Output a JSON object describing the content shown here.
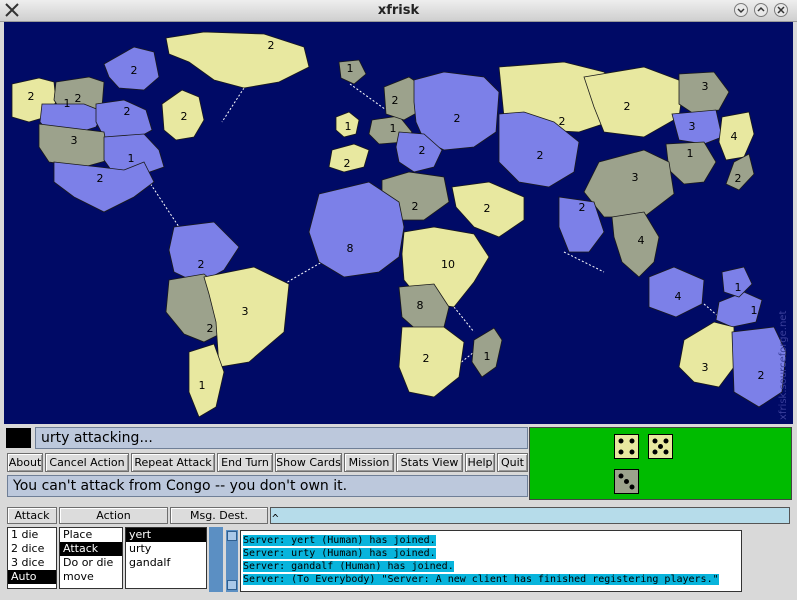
{
  "window": {
    "title": "xfrisk"
  },
  "map": {
    "watermark": "xfrisk.sourceforge.net",
    "colors": {
      "ocean": "#000a66",
      "yellow": "#e8e8a0",
      "blue": "#7c80e8",
      "gray": "#9ca28c"
    },
    "armies": [
      {
        "n": "2",
        "c": "yellow"
      },
      {
        "n": "2",
        "c": "gray"
      },
      {
        "n": "2",
        "c": "blue"
      },
      {
        "n": "2",
        "c": "yellow"
      },
      {
        "n": "1",
        "c": "blue"
      },
      {
        "n": "2",
        "c": "blue"
      },
      {
        "n": "2",
        "c": "yellow"
      },
      {
        "n": "3",
        "c": "gray"
      },
      {
        "n": "1",
        "c": "blue"
      },
      {
        "n": "2",
        "c": "blue"
      },
      {
        "n": "1",
        "c": "gray"
      },
      {
        "n": "1",
        "c": "yellow"
      },
      {
        "n": "1",
        "c": "gray"
      },
      {
        "n": "2",
        "c": "yellow"
      },
      {
        "n": "2",
        "c": "gray"
      },
      {
        "n": "2",
        "c": "blue"
      },
      {
        "n": "2",
        "c": "blue"
      },
      {
        "n": "2",
        "c": "yellow"
      },
      {
        "n": "2",
        "c": "yellow"
      },
      {
        "n": "2",
        "c": "blue"
      },
      {
        "n": "3",
        "c": "gray"
      },
      {
        "n": "3",
        "c": "blue"
      },
      {
        "n": "4",
        "c": "yellow"
      },
      {
        "n": "1",
        "c": "gray"
      },
      {
        "n": "2",
        "c": "gray"
      },
      {
        "n": "3",
        "c": "gray"
      },
      {
        "n": "2",
        "c": "gray"
      },
      {
        "n": "2",
        "c": "blue"
      },
      {
        "n": "2",
        "c": "yellow"
      },
      {
        "n": "4",
        "c": "gray"
      },
      {
        "n": "8",
        "c": "blue"
      },
      {
        "n": "10",
        "c": "yellow"
      },
      {
        "n": "2",
        "c": "blue"
      },
      {
        "n": "2",
        "c": "gray"
      },
      {
        "n": "3",
        "c": "yellow"
      },
      {
        "n": "1",
        "c": "yellow"
      },
      {
        "n": "8",
        "c": "gray"
      },
      {
        "n": "2",
        "c": "yellow"
      },
      {
        "n": "1",
        "c": "gray"
      },
      {
        "n": "4",
        "c": "blue"
      },
      {
        "n": "1",
        "c": "blue"
      },
      {
        "n": "1",
        "c": "blue"
      },
      {
        "n": "3",
        "c": "yellow"
      },
      {
        "n": "2",
        "c": "blue"
      }
    ]
  },
  "status": {
    "player_color": "#000000",
    "turn_text": "urty attacking...",
    "message": "You can't attack from Congo -- you don't own it."
  },
  "buttons": [
    "About",
    "Cancel Action",
    "Repeat Attack",
    "End Turn",
    "Show Cards",
    "Mission",
    "Stats View",
    "Help",
    "Quit"
  ],
  "dice": {
    "attack": [
      4,
      5
    ],
    "defend": [
      3
    ]
  },
  "tabs": {
    "attack": "Attack",
    "action": "Action",
    "msg_dest": "Msg. Dest."
  },
  "chat_input": {
    "value": "^"
  },
  "attack_options": [
    "1 die",
    "2 dice",
    "3 dice",
    "Auto"
  ],
  "attack_selected": "Auto",
  "action_options": [
    "Place",
    "Attack",
    "Do or die",
    "move"
  ],
  "action_selected": "Attack",
  "players": [
    "yert",
    "urty",
    "gandalf"
  ],
  "player_selected": "yert",
  "messages": [
    "Server: yert (Human) has joined.",
    "Server: urty (Human) has joined.",
    "Server: gandalf (Human) has joined.",
    "Server: (To Everybody) \"Server: A new client has finished registering players.\""
  ]
}
